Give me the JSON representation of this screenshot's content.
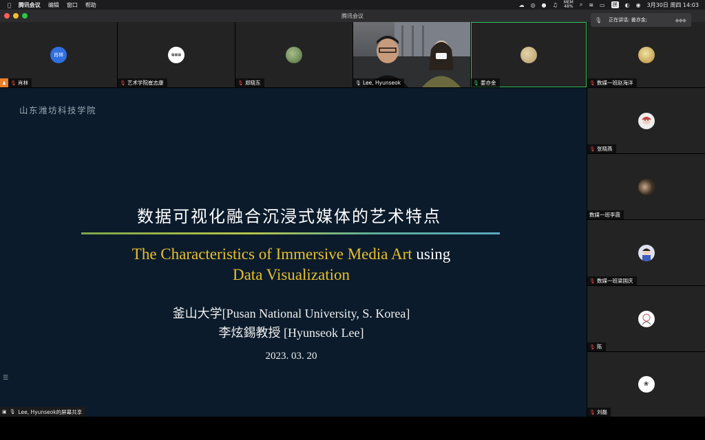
{
  "menubar": {
    "app_name": "腾讯会议",
    "menus": [
      "编辑",
      "窗口",
      "帮助"
    ],
    "mem_label": "MEM",
    "mem_value": "48%",
    "input_method": "拼",
    "datetime": "3月30日 周四 14:03"
  },
  "window": {
    "title": "腾讯会议"
  },
  "speaking_toast": {
    "label": "正在讲话: 姜亦金;"
  },
  "top_tiles": [
    {
      "name": "肖林",
      "avatar_text": "肖林",
      "avatar_color": "#2f6fe0",
      "host": true,
      "mic": "red"
    },
    {
      "name": "艺术学院崔志康",
      "avatar_text": "",
      "avatar_color": "#ffffff",
      "host": false,
      "mic": "red"
    },
    {
      "name": "郑晓东",
      "avatar_text": "",
      "avatar_color": "#6b8f5a",
      "host": false,
      "mic": "red"
    },
    {
      "name": "Lee, Hyunseok",
      "avatar_text": "",
      "avatar_color": "",
      "host": false,
      "mic": "white",
      "video": true
    },
    {
      "name": "姜亦金",
      "avatar_text": "",
      "avatar_color": "#c9b48a",
      "host": false,
      "mic": "green",
      "speaking": true
    }
  ],
  "right_tiles": [
    {
      "name": "数媒一班赵海洋",
      "avatar_color": "#d8c27a",
      "mic": "red"
    },
    {
      "name": "张晓燕",
      "avatar_color": "#eeeeee",
      "mic": "red"
    },
    {
      "name": "数媒一班李霞",
      "avatar_color": "#4a3a2a",
      "mic": "none"
    },
    {
      "name": "数媒一班梁国庆",
      "avatar_color": "#d9d9e6",
      "mic": "red"
    },
    {
      "name": "陈",
      "avatar_color": "#ffffff",
      "mic": "red"
    },
    {
      "name": "刘磊",
      "avatar_color": "#ffffff",
      "mic": "red"
    }
  ],
  "slide": {
    "school": "山东潍坊科技学院",
    "title_zh": "数据可视化融合沉浸式媒体的艺术特点",
    "title_en_gold_1": "The Characteristics of Immersive Media Art",
    "title_en_white": " using",
    "title_en_gold_2": "Data Visualization",
    "university": "釜山大学[Pusan National University, S. Korea]",
    "professor": "李炫錫教授 [Hyunseok Lee]",
    "date": "2023. 03. 20"
  },
  "share_label": "Lee, Hyunseok的屏幕共享",
  "colors": {
    "slide_bg": "#0b1b2b",
    "gold": "#e9c02e",
    "speaking": "#37c163",
    "muted": "#e04b4b"
  }
}
